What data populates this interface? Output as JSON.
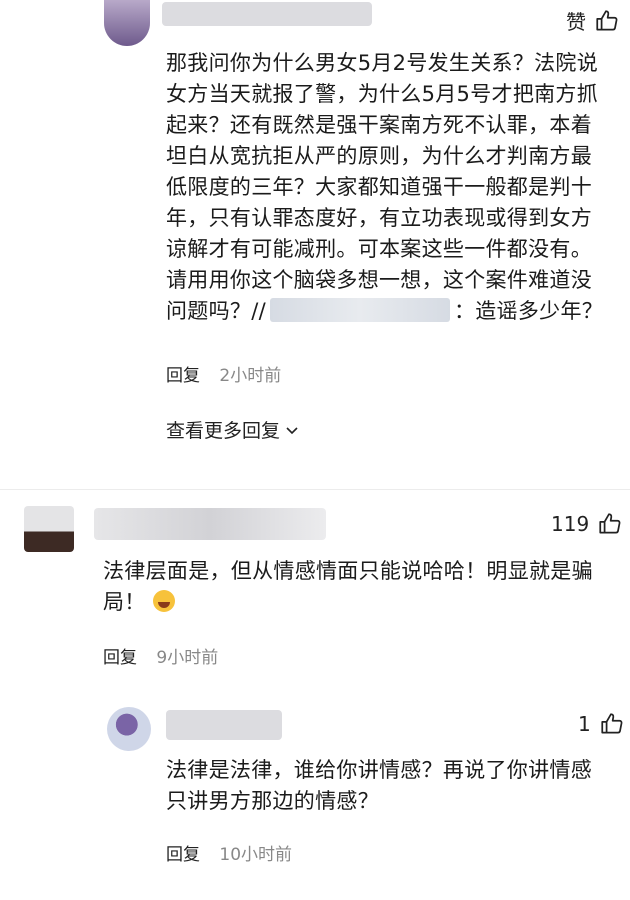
{
  "comment1": {
    "like_label": "赞",
    "text_lines": [
      "那我问你为什么男女5月2号发生关系？法院说",
      "女方当天就报了警，为什么5月5号才把南方抓",
      "起来？还有既然是强干案南方死不认罪，本着",
      "坦白从宽抗拒从严的原则，为什么才判南方最",
      "低限度的三年？大家都知道强干一般都是判十",
      "年，只有认罪态度好，有立功表现或得到女方",
      "谅解才有可能减刑。可本案这些一件都没有。",
      "请用用你这个脑袋多想一想，这个案件难道没"
    ],
    "last_line_prefix": "问题吗？//",
    "last_line_suffix": "：造谣多少年？",
    "reply_label": "回复",
    "time": "2小时前",
    "more_replies": "查看更多回复"
  },
  "comment2": {
    "likes": "119",
    "text_line1": "法律层面是，但从情感情面只能说哈哈！明显就是骗",
    "text_line2": "局！",
    "reply_label": "回复",
    "time": "9小时前"
  },
  "comment3": {
    "likes": "1",
    "text_line1": "法律是法律，谁给你讲情感？再说了你讲情感",
    "text_line2": "只讲男方那边的情感？",
    "reply_label": "回复",
    "time": "10小时前"
  },
  "icons": {
    "like": "thumbs-up-icon",
    "chevron": "chevron-down-icon"
  },
  "colors": {
    "text": "#1b1b1b",
    "meta": "#888888",
    "background": "#ffffff"
  }
}
